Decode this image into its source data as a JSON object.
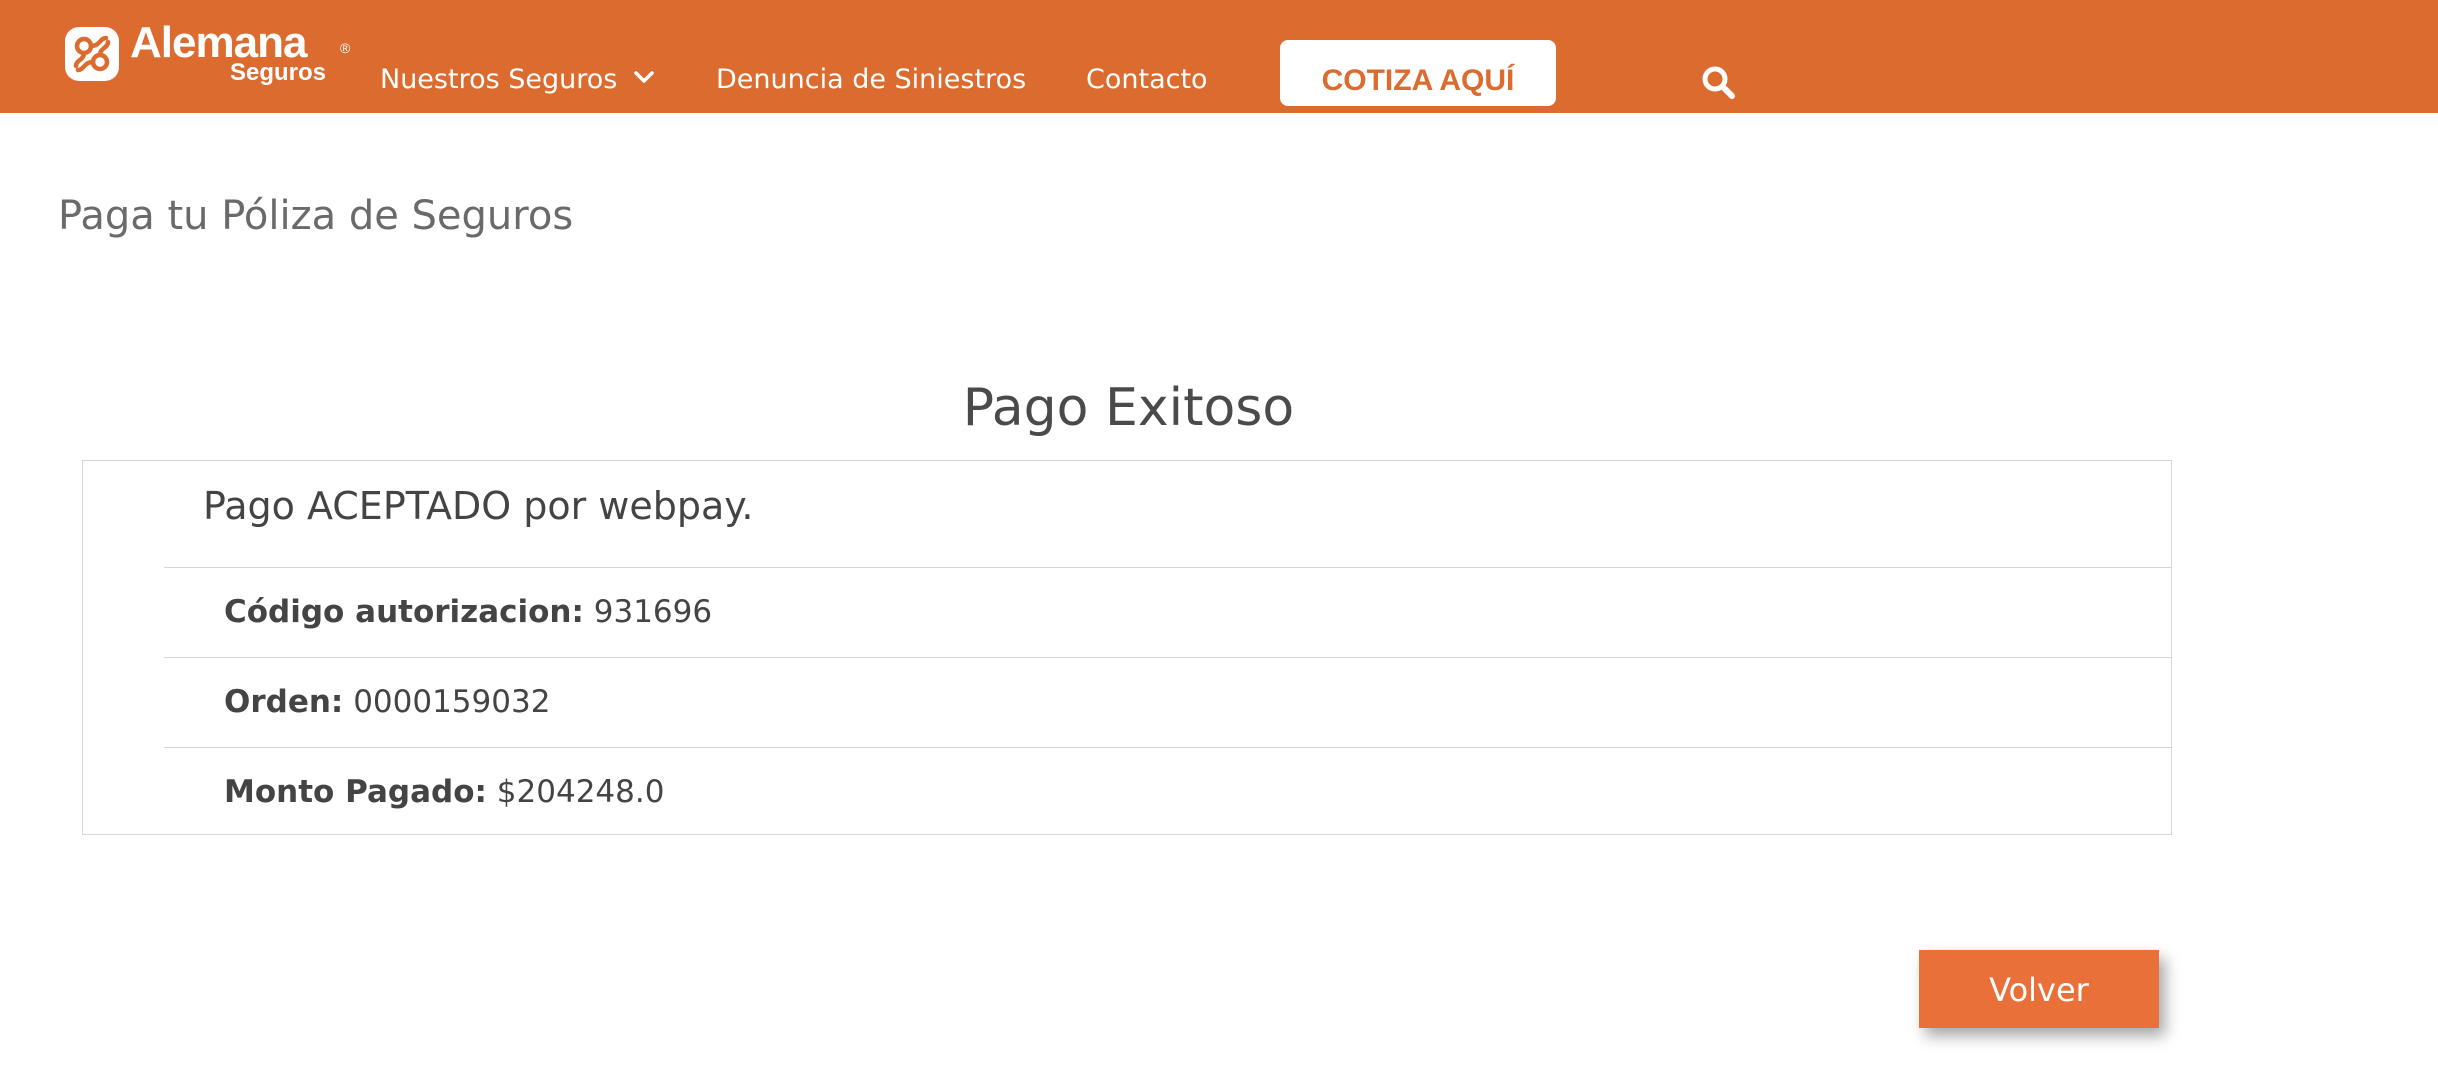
{
  "header": {
    "logo": {
      "name": "Alemana",
      "sub": "Seguros",
      "registered": "®"
    },
    "nav": [
      {
        "label": "Nuestros Seguros",
        "has_dropdown": true
      },
      {
        "label": "Denuncia de Siniestros"
      },
      {
        "label": "Contacto"
      }
    ],
    "cta_label": "COTIZA AQUÍ",
    "search_icon": "search-icon"
  },
  "page": {
    "title": "Paga tu Póliza de Seguros"
  },
  "result": {
    "heading": "Pago Exitoso",
    "status": "Pago ACEPTADO por webpay.",
    "details": [
      {
        "label": "Código autorizacion:",
        "value": "931696"
      },
      {
        "label": "Orden:",
        "value": "0000159032"
      },
      {
        "label": "Monto Pagado:",
        "value": "$204248.0"
      }
    ]
  },
  "actions": {
    "back_label": "Volver"
  },
  "colors": {
    "brand": "#dc6b2f",
    "button": "#ea7039",
    "text": "#444444"
  }
}
